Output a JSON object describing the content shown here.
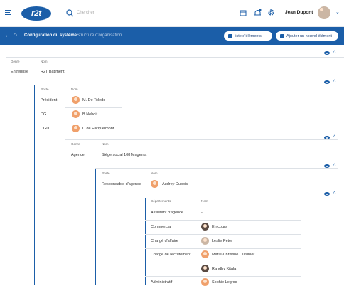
{
  "header": {
    "logo_text": "r2t",
    "search_placeholder": "Chercher",
    "user_name": "Jean Dupont"
  },
  "nav": {
    "breadcrumb_current": "Configuration du système",
    "breadcrumb_sep": "›",
    "breadcrumb_sub": "Structure d'organisation",
    "btn_list": "liste d'éléments",
    "btn_add": "Ajouter un nouvel élément"
  },
  "sections": {
    "s1": {
      "col1": "Genre",
      "col2": "Nom",
      "type": "Entreprise",
      "name": "R2T Batiment"
    },
    "s2": {
      "col1": "Poste",
      "col2": "Nom",
      "rows": [
        {
          "role": "Président",
          "name": "M. De Toledo"
        },
        {
          "role": "DG",
          "name": "B Neboit"
        },
        {
          "role": "DGD",
          "name": "C de Filcquelmont"
        }
      ]
    },
    "s3": {
      "col1": "Genre",
      "col2": "Nom",
      "type": "Agence",
      "name": "Siège social 108 Magenta"
    },
    "s4": {
      "col1": "Poste",
      "col2": "Nom",
      "role": "Responsable d'agence",
      "name": "Audrey Dubois"
    },
    "s5": {
      "col1": "Départements",
      "col2": "Nom",
      "rows": [
        {
          "dept": "Assistant d'agence",
          "name": "-"
        },
        {
          "dept": "Commercial",
          "name": "En cours"
        },
        {
          "dept": "Chargé d'affaire",
          "name": "Leslie Peter"
        },
        {
          "dept": "Chargé de recrutement",
          "name": "Marie-Christine Cuisinier"
        },
        {
          "dept": "",
          "name": "Randhy Kitala"
        },
        {
          "dept": "Administratif",
          "name": "Sophie Legros"
        }
      ]
    }
  }
}
